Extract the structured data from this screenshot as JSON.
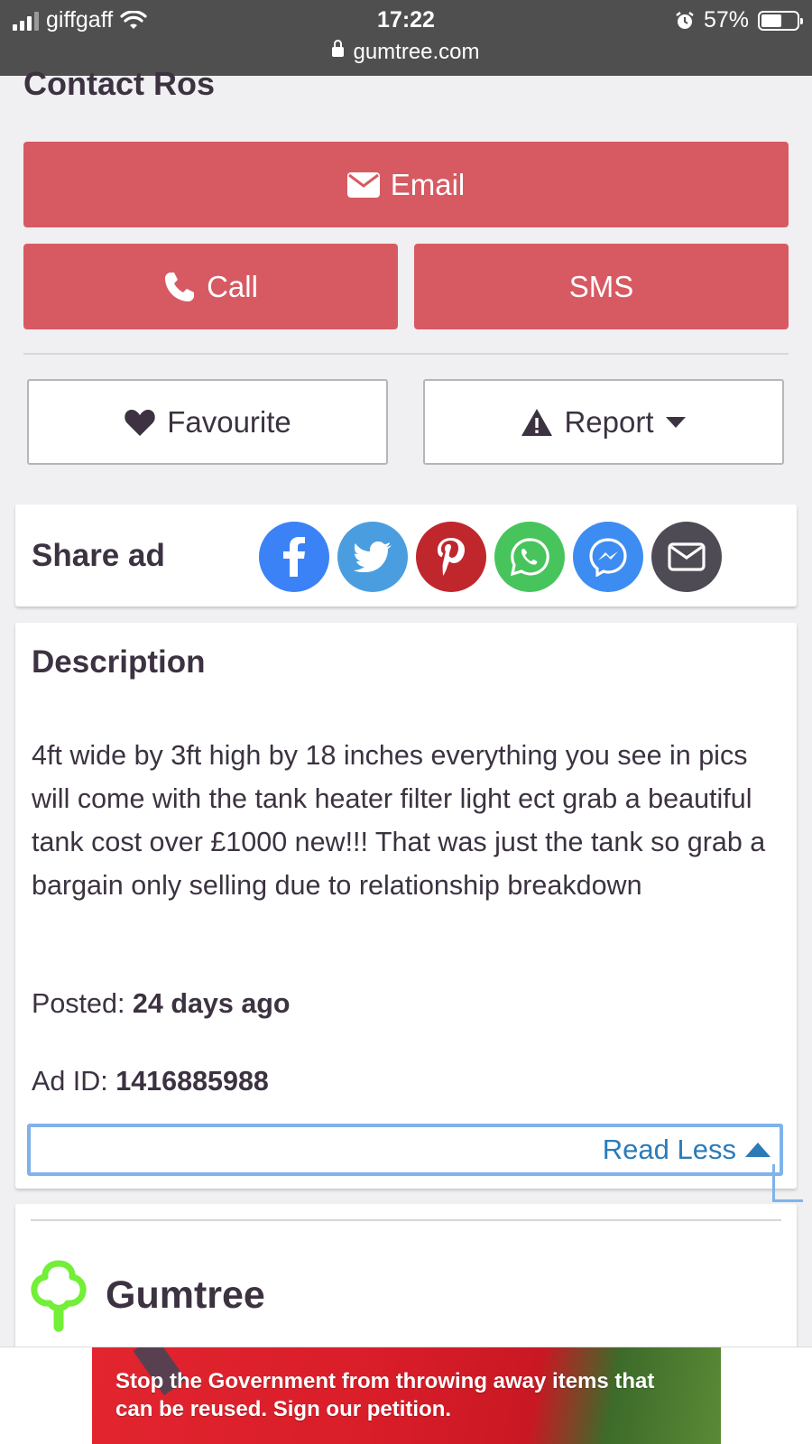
{
  "status_bar": {
    "carrier": "giffgaff",
    "time": "17:22",
    "url": "gumtree.com",
    "battery": "57%"
  },
  "contact": {
    "title": "Contact Ros",
    "email_label": "Email",
    "call_label": "Call",
    "sms_label": "SMS",
    "favourite_label": "Favourite",
    "report_label": "Report"
  },
  "share": {
    "title": "Share ad",
    "networks": [
      {
        "name": "facebook",
        "color": "#3b82f6"
      },
      {
        "name": "twitter",
        "color": "#4a9ee0"
      },
      {
        "name": "pinterest",
        "color": "#c0272d"
      },
      {
        "name": "whatsapp",
        "color": "#48c45c"
      },
      {
        "name": "messenger",
        "color": "#3d8cf2"
      },
      {
        "name": "email",
        "color": "#4f4b55"
      }
    ]
  },
  "description": {
    "title": "Description",
    "body": "4ft wide by 3ft high by 18 inches everything you see in pics will come with the tank heater filter light ect grab a beautiful tank cost over £1000 new!!! That was just the tank so grab a bargain only selling due to relationship breakdown",
    "posted_label": "Posted:",
    "posted_value": "24 days ago",
    "ad_id_label": "Ad ID:",
    "ad_id_value": "1416885988",
    "read_less_label": "Read Less"
  },
  "footer": {
    "brand": "Gumtree",
    "brand_color": "#72ef36"
  },
  "ad": {
    "text": "Stop the Government from throwing away items that can be reused. Sign our petition."
  },
  "colors": {
    "primary_red": "#d75a63",
    "link_blue": "#2b7bb9",
    "text_dark": "#3c3241"
  }
}
